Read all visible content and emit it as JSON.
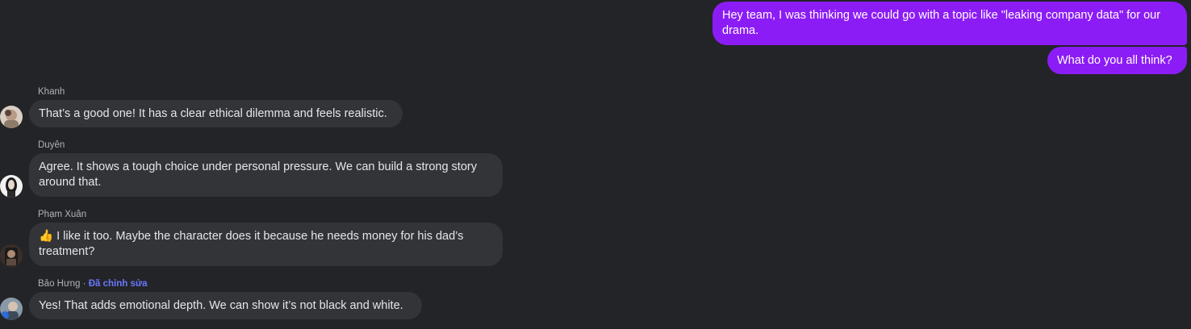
{
  "outgoing": [
    {
      "text": "Hey team, I was thinking we could go with a topic like \"leaking company data\" for our drama."
    },
    {
      "text": "What do you all think?"
    }
  ],
  "incoming": [
    {
      "sender": "Khanh",
      "edited_note": "",
      "text": "That’s a good one! It has a clear ethical dilemma and feels realistic.",
      "avatar": "avatar-khanh"
    },
    {
      "sender": "Duyên",
      "edited_note": "",
      "text": "Agree. It shows a tough choice under personal pressure. We can build a strong story around that.",
      "avatar": "avatar-duyen"
    },
    {
      "sender": "Phạm Xuân",
      "edited_note": "",
      "emoji": "👍",
      "text": "I like it too. Maybe the character does it because he needs money for his dad’s treatment?",
      "avatar": "avatar-pham-xuan"
    },
    {
      "sender": "Bảo Hưng",
      "separator": " · ",
      "edited_note": "Đã chỉnh sửa",
      "text": "Yes! That adds emotional depth. We can show it’s not black and white.",
      "avatar": "avatar-bao-hung"
    }
  ],
  "colors": {
    "background": "#232427",
    "outgoing_bubble": "#8c1cf5",
    "incoming_bubble": "#333437",
    "edited_note": "#6a78ff"
  }
}
